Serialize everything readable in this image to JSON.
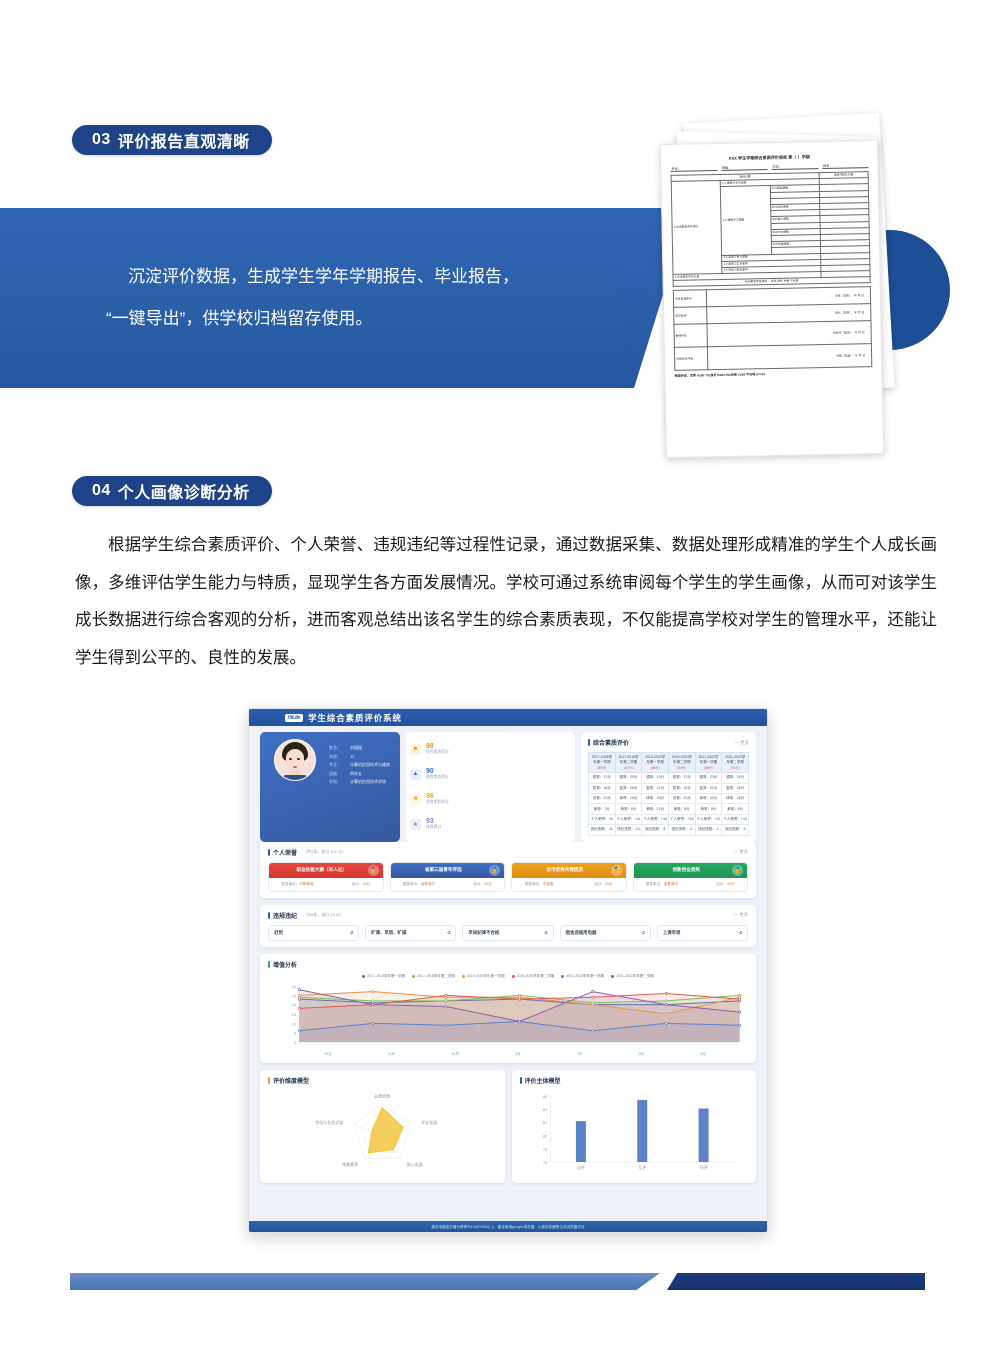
{
  "sections": [
    {
      "num": "03",
      "title": "评价报告直观清晰"
    },
    {
      "num": "04",
      "title": "个人画像诊断分析"
    }
  ],
  "banner": {
    "line1": "沉淀评价数据，生成学生学年学期报告、毕业报告，",
    "line2": "“一键导出”，供学校归档留存使用。"
  },
  "paragraph": "根据学生综合素质评价、个人荣誉、违规违纪等过程性记录，通过数据采集、数据处理形成精准的学生个人成长画像，多维评估学生能力与特质，显现学生各方面发展情况。学校可通过系统审阅每个学生的学生画像，从而可对该学生成长数据进行综合客观的分析，进而客观总结出该名学生的综合素质表现，不仅能提高学校对学生的管理水平，还能让学生得到公平的、良性的发展。",
  "report_form": {
    "title": "XXX 学生学期综合素质评价报告     第（ ）学期",
    "fields": [
      "专业：",
      "班级：",
      "学年：",
      "姓名："
    ],
    "col_head_left": "指标分数",
    "col_head_right": "等级评定及分数",
    "rows": [
      "1.1 课程学业完成度",
      "公共基础课程",
      "公共选修课程",
      "专业核心课程",
      "专业方向课程",
      "专业拓展课程",
      "1.3 运动与身心健康",
      "1.4 美育与艺术素养",
      "1.5 劳动与职业素养",
      "2 综合素质写实记录"
    ],
    "group_label": "1 综合素质评价得分",
    "subgroup_label": "1.2 课程学习质量",
    "signature_rows": [
      {
        "label": "学生自我评价",
        "sign": "学生（签名）：   年  月  日"
      },
      {
        "label": "同学互评",
        "sign": "班长（签名）：   年  月  日"
      },
      {
        "label": "教师评价",
        "sign": "班主任（签名）：   年  月  日"
      },
      {
        "label": "学校综合评语",
        "sign": "学校（签章）：   年  月  日"
      }
    ],
    "score_line": "综合素质评定等级：     优秀   良好   合格   不合格",
    "footer": "等级评定：优秀 A≥85    70≤良好 B≤84    60≤合格 C≤69    不合格 D＜60"
  },
  "dashboard": {
    "app_logo": "HiLife",
    "app_title": "学生综合素质评价系统",
    "profile": {
      "fields": [
        {
          "key": "姓名：",
          "value": "刘园园"
        },
        {
          "key": "年龄：",
          "value": "12"
        },
        {
          "key": "专业：",
          "value": "计算机应用技术与维修"
        },
        {
          "key": "班级：",
          "value": "四年五"
        },
        {
          "key": "学校：",
          "value": "计算机应用技术学校"
        }
      ]
    },
    "scores": [
      {
        "value": "98",
        "label": "综合素质得分",
        "icon": "trophy-icon",
        "color": "#e8941f",
        "bg": "#fdf2e0"
      },
      {
        "value": "90",
        "label": "德育素质得分",
        "icon": "chart-icon",
        "color": "#3b6fd0",
        "bg": "#e7eefb"
      },
      {
        "value": "86",
        "label": "智育素质得分",
        "icon": "book-icon",
        "color": "#e8b020",
        "bg": "#fdf6e2"
      },
      {
        "value": "93",
        "label": "体育得分",
        "icon": "star-icon",
        "color": "#8f7fd8",
        "bg": "#efecfb"
      }
    ],
    "eval": {
      "title": "综合素质评价",
      "more": "— 更多",
      "columns": [
        {
          "term": "2017-2018学年第一学期",
          "total": "（89分）"
        },
        {
          "term": "2017-2018学年第二学期",
          "total": "（87分）"
        },
        {
          "term": "2019-2020学年第一学期",
          "total": "（88分）"
        },
        {
          "term": "2019-2020学年第二学期",
          "total": "（90分）"
        },
        {
          "term": "2021-2022学年第一学期",
          "total": "（86分）"
        },
        {
          "term": "2021-2022学年第二学期",
          "total": "（91分）"
        }
      ],
      "row_labels": [
        "德育",
        "智育",
        "体育",
        "美育",
        "个人荣誉",
        "违纪违规"
      ],
      "values": [
        [
          "德育：17分",
          "智育：16分",
          "体育：22分",
          "美育：7分",
          "个人荣誉：+8",
          "违纪违规：-12"
        ],
        [
          "德育：20分",
          "智育：26分",
          "体育：16分",
          "美育：6分",
          "个人荣誉：+16",
          "违纪违规：-10"
        ],
        [
          "德育：19分",
          "智育：21分",
          "体育：33分",
          "美育：12分",
          "个人荣誉：+18",
          "违纪违规：-8"
        ],
        [
          "德育：17分",
          "智育：23分",
          "体育：31分",
          "美育：8分",
          "个人荣誉：+26",
          "违纪违规：-4"
        ],
        [
          "德育：23分",
          "智育：22分",
          "体育：42分",
          "美育：9分",
          "个人荣誉：+12",
          "违纪违规：-2"
        ],
        [
          "德育：24分",
          "智育：28分",
          "体育：26分",
          "美育：6分",
          "个人荣誉：+10",
          "违纪违规：-3"
        ]
      ]
    },
    "honors": {
      "title": "个人荣誉",
      "count": "（共9条，加分 100 分）",
      "more": "— 更多",
      "items": [
        {
          "name": "职业技能大赛（市人社）",
          "color": "#e8453c",
          "color2": "#d13a31",
          "org_label": "颁奖单位：",
          "org": "市教育局",
          "score_label": "加分：",
          "score": "25分"
        },
        {
          "name": "省第三届青年评选",
          "color": "#3f6fc4",
          "color2": "#35599f",
          "org_label": "颁奖单位：",
          "org": "省教育厅",
          "score_label": "加分：",
          "score": "30分"
        },
        {
          "name": "全市优秀共青团员",
          "color": "#eda01e",
          "color2": "#df8f15",
          "org_label": "颁奖单位：",
          "org": "市团委",
          "score_label": "加分：",
          "score": "25分"
        },
        {
          "name": "创新创业类奖",
          "color": "#26a961",
          "color2": "#1f9354",
          "org_label": "颁奖单位：",
          "org": "省教育厅",
          "score_label": "加分：",
          "score": "20分"
        }
      ]
    },
    "violations": {
      "title": "违规违纪",
      "count": "（共5条，减分 10 分）",
      "more": "— 更多",
      "items": [
        {
          "name": "迟到",
          "points": "-2"
        },
        {
          "name": "旷课、早退、旷操",
          "points": "-2"
        },
        {
          "name": "早间纪律不合格",
          "points": "-2"
        },
        {
          "name": "宿舍违规用电器",
          "points": "-2"
        },
        {
          "name": "上课早退",
          "points": "-2"
        }
      ]
    },
    "footer": "建议电脑显示器分辨率为1440*900以上，建议使用google浏览器、火狐浏览器等主流浏览器访问"
  },
  "chart_data": [
    {
      "type": "line",
      "title": "增值分析",
      "xlabel": "",
      "ylabel": "",
      "x": [
        "10月",
        "11月",
        "12月",
        "1月",
        "2月",
        "3月",
        "4月"
      ],
      "ylim": [
        0,
        30
      ],
      "yticks": [
        0,
        5,
        10,
        15,
        20,
        25,
        30
      ],
      "grid": false,
      "legend_position": "top",
      "series": [
        {
          "name": "2017-2018学年第一学期",
          "color": "#6c6fa8",
          "values": [
            23,
            21,
            22,
            23,
            20,
            20,
            22
          ]
        },
        {
          "name": "2017-2018学年第二学期",
          "color": "#79c15e",
          "values": [
            24,
            22,
            22,
            25,
            21,
            22,
            25
          ]
        },
        {
          "name": "2019-2020学年第一学期",
          "color": "#e8934a",
          "values": [
            25,
            27,
            24,
            24,
            20,
            15,
            24
          ]
        },
        {
          "name": "2019-2020学年第二学期",
          "color": "#e05b53",
          "values": [
            18,
            20,
            25,
            23,
            24,
            26,
            23
          ]
        },
        {
          "name": "2021-2022学年第一学期",
          "color": "#5b82c9",
          "values": [
            6,
            10,
            9,
            11,
            6,
            10,
            9
          ]
        },
        {
          "name": "2021-2022学年第二学期",
          "color": "#8e5fa8",
          "values": [
            28,
            20,
            19,
            11,
            27,
            20,
            16
          ]
        }
      ]
    },
    {
      "type": "radar",
      "title": "评价维度模型",
      "axes": [
        "品德发展",
        "学业发展",
        "身心发展",
        "审美素养",
        "劳动与社会实践"
      ],
      "max": 100,
      "values": [
        88,
        72,
        64,
        78,
        36
      ],
      "color": "#f2c230"
    },
    {
      "type": "bar",
      "title": "评价主体模型",
      "categories": [
        "自评",
        "互评",
        "师评"
      ],
      "values": [
        82.2,
        85.4,
        84.1
      ],
      "ylim": [
        76,
        86
      ],
      "yticks": [
        76,
        78,
        80,
        82,
        84,
        86
      ],
      "color": "#5b82c9",
      "xlabel": "",
      "ylabel": ""
    }
  ]
}
